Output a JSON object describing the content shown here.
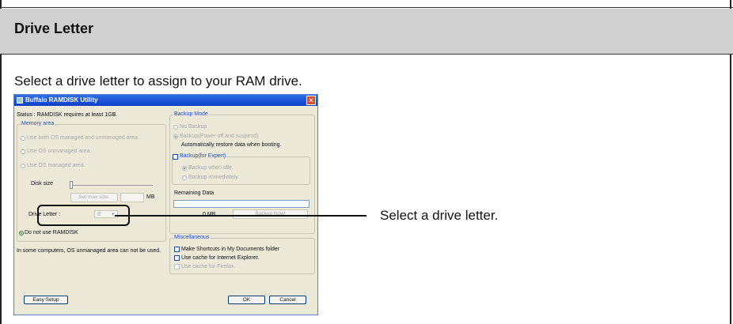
{
  "section": {
    "heading": "Drive Letter",
    "intro": "Select a drive letter to assign to your RAM drive.",
    "callout": "Select a drive letter."
  },
  "window": {
    "title": "Buffalo RAMDISK Utility",
    "status": "Status : RAMDISK requires at least 1GB.",
    "memory_area": {
      "legend": "Memory area",
      "options": [
        "Use both OS managed and unmanaged area.",
        "Use OS unmanaged area.",
        "Use OS managed area."
      ],
      "disk_size_label": "Disk size",
      "set_max_label": "Set max size.",
      "unit": "MB",
      "drive_letter_label": "Drive Letter :",
      "drive_letter_value": "E",
      "do_not_use": "Do not use RAMDISK"
    },
    "note": "In some computers, OS unmanaged area can not be used.",
    "backup_mode": {
      "legend": "Backup Mode",
      "no_backup": "No Backup",
      "backup": "Backup(Power off and suspend)",
      "auto_restore": "Automatically restore data when booting."
    },
    "backup_expert": {
      "legend": "Backup(for Expert)",
      "when_idle": "Backup when idle.",
      "immediately": "Backup immediately."
    },
    "remaining_data": {
      "label": "Remaining Data",
      "value": "0 MB",
      "backup_now": "Backup Now!"
    },
    "misc": {
      "legend": "Miscellaneous",
      "shortcuts": "Make Shortcuts in My Documents folder",
      "cache_ie": "Use cache for Internet Explorer.",
      "cache_firefox": "Use cache for Firefox."
    },
    "buttons": {
      "easy_setup": "Easy Setup",
      "ok": "OK",
      "cancel": "Cancel"
    }
  }
}
